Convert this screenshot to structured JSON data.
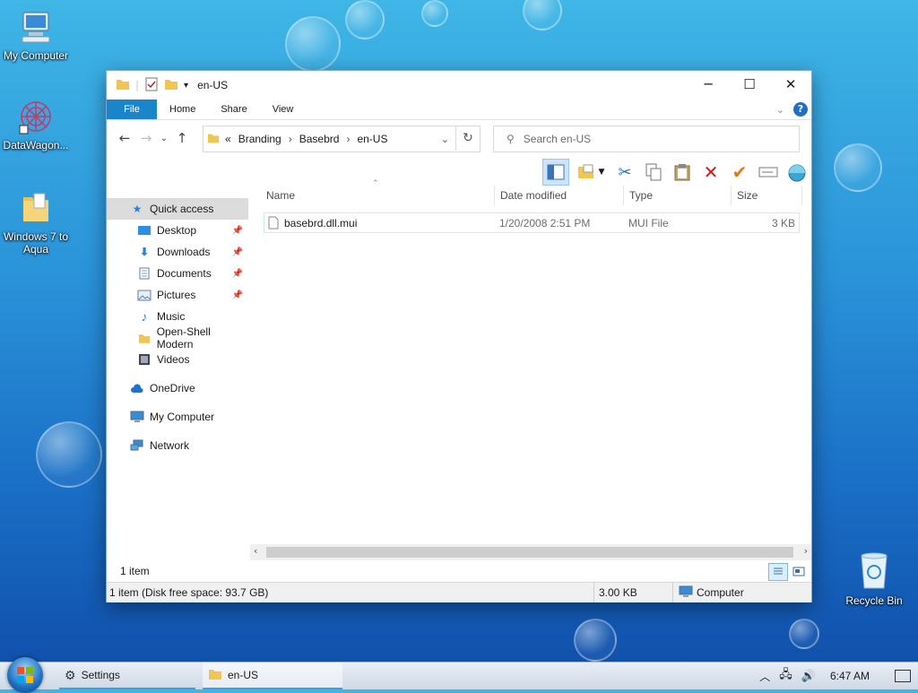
{
  "desktop": {
    "icons": [
      {
        "label": "My Computer",
        "icon": "monitor-icon"
      },
      {
        "label": "DataWagon...",
        "icon": "spiral-app-icon"
      },
      {
        "label": "Windows 7 to Aqua",
        "icon": "folder-icon"
      },
      {
        "label": "Recycle Bin",
        "icon": "recycle-bin-icon"
      }
    ]
  },
  "window": {
    "title": "en-US",
    "controls": {
      "minimize": "─",
      "maximize": "☐",
      "close": "✕"
    },
    "ribbon": {
      "tabs": [
        "File",
        "Home",
        "Share",
        "View"
      ],
      "help": "?"
    },
    "address": {
      "overflow": "«",
      "crumbs": [
        "Branding",
        "Basebrd",
        "en-US"
      ],
      "search_placeholder": "Search en-US"
    },
    "nav": {
      "quick_access": "Quick access",
      "pinned": [
        {
          "label": "Desktop",
          "icon": "desktop-icon"
        },
        {
          "label": "Downloads",
          "icon": "download-icon"
        },
        {
          "label": "Documents",
          "icon": "document-icon"
        },
        {
          "label": "Pictures",
          "icon": "pictures-icon"
        }
      ],
      "others": [
        {
          "label": "Music",
          "icon": "music-icon"
        },
        {
          "label": "Open-Shell Modern",
          "icon": "folder-icon"
        },
        {
          "label": "Videos",
          "icon": "video-icon"
        }
      ],
      "onedrive": "OneDrive",
      "my_computer": "My Computer",
      "network": "Network"
    },
    "columns": [
      "Name",
      "Date modified",
      "Type",
      "Size"
    ],
    "files": [
      {
        "name": "basebrd.dll.mui",
        "date": "1/20/2008 2:51 PM",
        "type": "MUI File",
        "size": "3 KB"
      }
    ],
    "status": {
      "count": "1 item",
      "detail": "1 item (Disk free space: 93.7 GB)",
      "size": "3.00 KB",
      "location": "Computer"
    }
  },
  "taskbar": {
    "items": [
      "Settings",
      "en-US"
    ],
    "time": "6:47 AM"
  }
}
